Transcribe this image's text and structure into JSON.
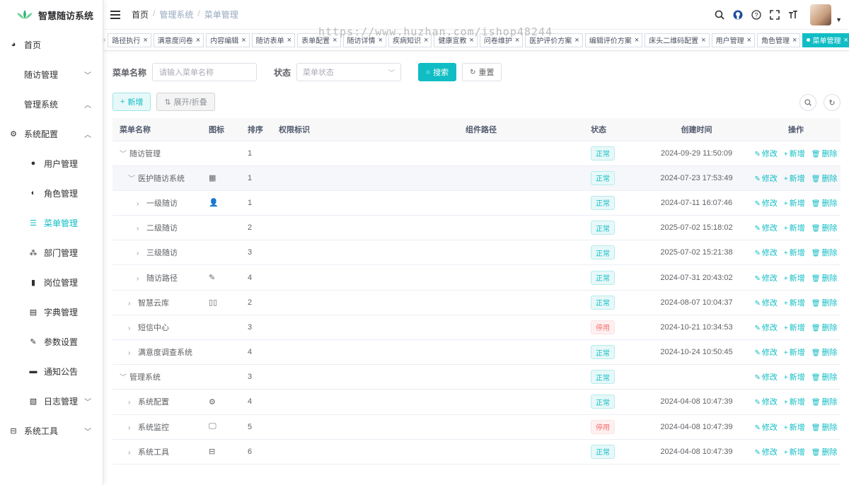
{
  "app": {
    "title": "智慧随访系统"
  },
  "sidebar": {
    "items": [
      {
        "label": "首页",
        "icon": "dashboard-icon"
      },
      {
        "label": "随访管理",
        "icon": "",
        "arrow": "down"
      },
      {
        "label": "管理系统",
        "icon": "",
        "arrow": "up"
      },
      {
        "label": "系统配置",
        "icon": "gear-icon",
        "arrow": "up"
      },
      {
        "label": "用户管理",
        "icon": "user-icon"
      },
      {
        "label": "角色管理",
        "icon": "people-icon"
      },
      {
        "label": "菜单管理",
        "icon": "tree-table-icon",
        "active": true
      },
      {
        "label": "部门管理",
        "icon": "org-chart-icon"
      },
      {
        "label": "岗位管理",
        "icon": "post-icon"
      },
      {
        "label": "字典管理",
        "icon": "dict-icon"
      },
      {
        "label": "参数设置",
        "icon": "edit-icon"
      },
      {
        "label": "通知公告",
        "icon": "message-icon"
      },
      {
        "label": "日志管理",
        "icon": "log-icon",
        "arrow": "down"
      },
      {
        "label": "系统工具",
        "icon": "toolbox-icon",
        "arrow": "down"
      }
    ]
  },
  "header": {
    "breadcrumb": [
      "首页",
      "管理系统",
      "菜单管理"
    ]
  },
  "watermark": "https://www.huzhan.com/ishop48244",
  "tags": [
    "路径执行",
    "满意度问卷",
    "内容编辑",
    "随访表单",
    "表单配置",
    "随访详情",
    "疾病知识",
    "健康宣教",
    "问卷维护",
    "医护评价方案",
    "编辑评价方案",
    "床头二维码配置",
    "用户管理",
    "角色管理",
    "菜单管理"
  ],
  "search": {
    "name_label": "菜单名称",
    "name_placeholder": "请输入菜单名称",
    "status_label": "状态",
    "status_placeholder": "菜单状态",
    "search_btn": "搜索",
    "reset_btn": "重置"
  },
  "toolbar": {
    "add_btn": "新增",
    "expand_btn": "展开/折叠"
  },
  "table": {
    "headers": [
      "菜单名称",
      "图标",
      "排序",
      "权限标识",
      "组件路径",
      "状态",
      "创建时间",
      "操作"
    ],
    "op_labels": {
      "edit": "修改",
      "add": "新增",
      "delete": "删除"
    },
    "rows": [
      {
        "name": "随访管理",
        "level": 0,
        "toggle": "v",
        "icon": "",
        "sort": "1",
        "status": "正常",
        "ok": true,
        "time": "2024-09-29 11:50:09"
      },
      {
        "name": "医护随访系统",
        "level": 1,
        "toggle": "v",
        "icon": "▦",
        "sort": "1",
        "status": "正常",
        "ok": true,
        "time": "2024-07-23 17:53:49",
        "hl": true
      },
      {
        "name": "一级随访",
        "level": 2,
        "toggle": ">",
        "icon": "👤",
        "sort": "1",
        "status": "正常",
        "ok": true,
        "time": "2024-07-11 16:07:46"
      },
      {
        "name": "二级随访",
        "level": 2,
        "toggle": ">",
        "icon": "",
        "sort": "2",
        "status": "正常",
        "ok": true,
        "time": "2025-07-02 15:18:02"
      },
      {
        "name": "三级随访",
        "level": 2,
        "toggle": ">",
        "icon": "",
        "sort": "3",
        "status": "正常",
        "ok": true,
        "time": "2025-07-02 15:21:38"
      },
      {
        "name": "随访路径",
        "level": 2,
        "toggle": ">",
        "icon": "✎",
        "sort": "4",
        "status": "正常",
        "ok": true,
        "time": "2024-07-31 20:43:02"
      },
      {
        "name": "智慧云库",
        "level": 1,
        "toggle": ">",
        "icon": "▯▯",
        "sort": "2",
        "status": "正常",
        "ok": true,
        "time": "2024-08-07 10:04:37"
      },
      {
        "name": "短信中心",
        "level": 1,
        "toggle": ">",
        "icon": "",
        "sort": "3",
        "status": "停用",
        "ok": false,
        "time": "2024-10-21 10:34:53"
      },
      {
        "name": "满意度调查系统",
        "level": 1,
        "toggle": ">",
        "icon": "",
        "sort": "4",
        "status": "正常",
        "ok": true,
        "time": "2024-10-24 10:50:45"
      },
      {
        "name": "管理系统",
        "level": 0,
        "toggle": "v",
        "icon": "",
        "sort": "3",
        "status": "正常",
        "ok": true,
        "time": ""
      },
      {
        "name": "系统配置",
        "level": 1,
        "toggle": ">",
        "icon": "⚙",
        "sort": "4",
        "status": "正常",
        "ok": true,
        "time": "2024-04-08 10:47:39"
      },
      {
        "name": "系统监控",
        "level": 1,
        "toggle": ">",
        "icon": "🖵",
        "sort": "5",
        "status": "停用",
        "ok": false,
        "time": "2024-04-08 10:47:39"
      },
      {
        "name": "系统工具",
        "level": 1,
        "toggle": ">",
        "icon": "⊟",
        "sort": "6",
        "status": "正常",
        "ok": true,
        "time": "2024-04-08 10:47:39"
      }
    ]
  },
  "colors": {
    "accent": "#11bdc4",
    "danger": "#f56c6c"
  }
}
